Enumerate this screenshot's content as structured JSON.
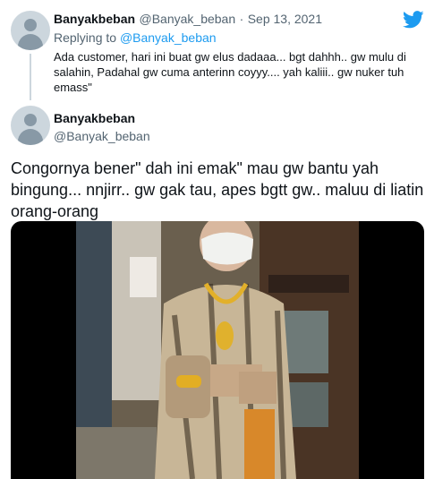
{
  "reply_tweet": {
    "name": "Banyakbeban",
    "handle": "@Banyak_beban",
    "separator": "·",
    "date": "Sep 13, 2021",
    "replying_prefix": "Replying to",
    "replying_to": "@Banyak_beban",
    "text": "Ada customer, hari ini buat gw elus dadaaa... bgt dahhh.. gw mulu di salahin, Padahal gw cuma anterinn coyyy.... yah kaliii.. gw nuker tuh emass\""
  },
  "main_tweet": {
    "name": "Banyakbeban",
    "handle": "@Banyak_beban",
    "text": "Congornya bener\" dah ini emak\" mau gw bantu yah bingung... nnjirr.. gw gak tau, apes bgtt gw.. maluu di liatin orang-orang"
  },
  "icons": {
    "brand": "twitter-bird-icon",
    "avatar": "default-avatar-icon"
  },
  "colors": {
    "accent": "#1d9bf0",
    "muted": "#536471",
    "text": "#0f1419"
  }
}
